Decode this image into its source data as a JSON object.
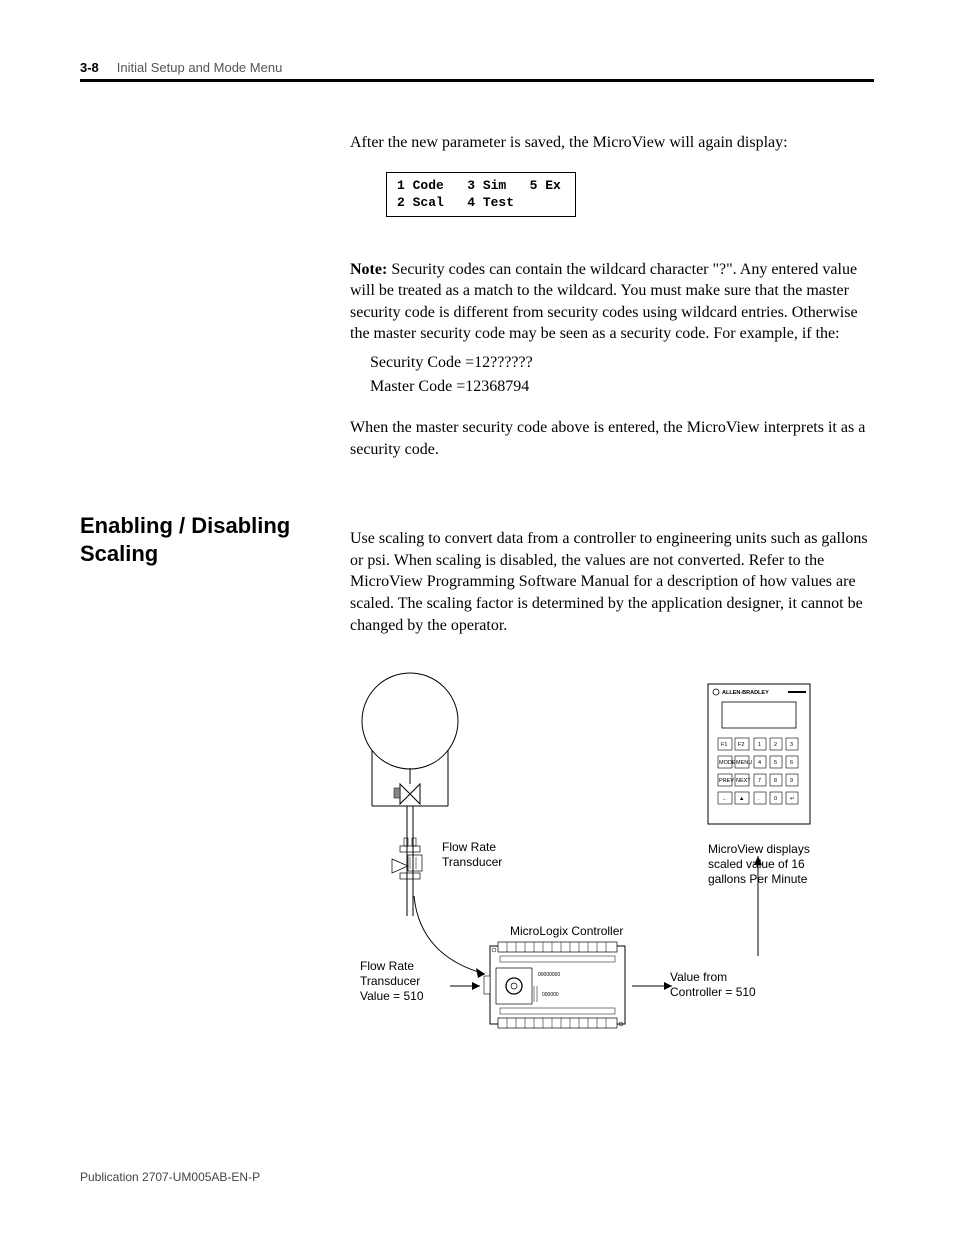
{
  "header": {
    "page": "3-8",
    "section": "Initial Setup and Mode Menu"
  },
  "content": {
    "para1": "After the new parameter is saved, the MicroView will again display:",
    "displayBox": "1 Code   3 Sim   5 Ex\n2 Scal   4 Test",
    "noteLabel": "Note:",
    "noteBody": "  Security codes can contain the wildcard character \"?\". Any entered value will be treated as a match to the wildcard. You must make sure that the master security code is different from security codes using wildcard entries. Otherwise the master security code may be seen as a security code. For example, if the:",
    "codeLine1": "Security Code =12??????",
    "codeLine2": "Master Code =12368794",
    "para2": "When the master security code above is entered, the MicroView interprets it as a security code.",
    "sectionHeading": "Enabling / Disabling Scaling",
    "para3": "Use scaling to convert data from a controller to engineering units such as gallons or psi. When scaling is disabled, the values are not converted. Refer to the MicroView Programming Software Manual for a description of how values are scaled. The scaling factor is determined by the application designer, it cannot be changed by the operator."
  },
  "diagram": {
    "flowRateTransducer": "Flow Rate\nTransducer",
    "flowRateValue": "Flow Rate\nTransducer\nValue = 510",
    "microLogix": "MicroLogix Controller",
    "valueFrom": "Value from\nController = 510",
    "mvDisplays": "MicroView displays\nscaled value of 16\ngallons Per Minute",
    "brand": "ALLEN-BRADLEY",
    "keys": {
      "r1": [
        "F1",
        "F2",
        "1",
        "2",
        "3"
      ],
      "r2": [
        "MODE",
        "MENU",
        "4",
        "5",
        "6"
      ],
      "r3": [
        "PREV",
        "NEXT",
        "7",
        "8",
        "9"
      ],
      "r4": [
        "←",
        "▲",
        ".",
        "0",
        "↵"
      ]
    }
  },
  "footer": {
    "pub": "Publication 2707-UM005AB-EN-P"
  }
}
